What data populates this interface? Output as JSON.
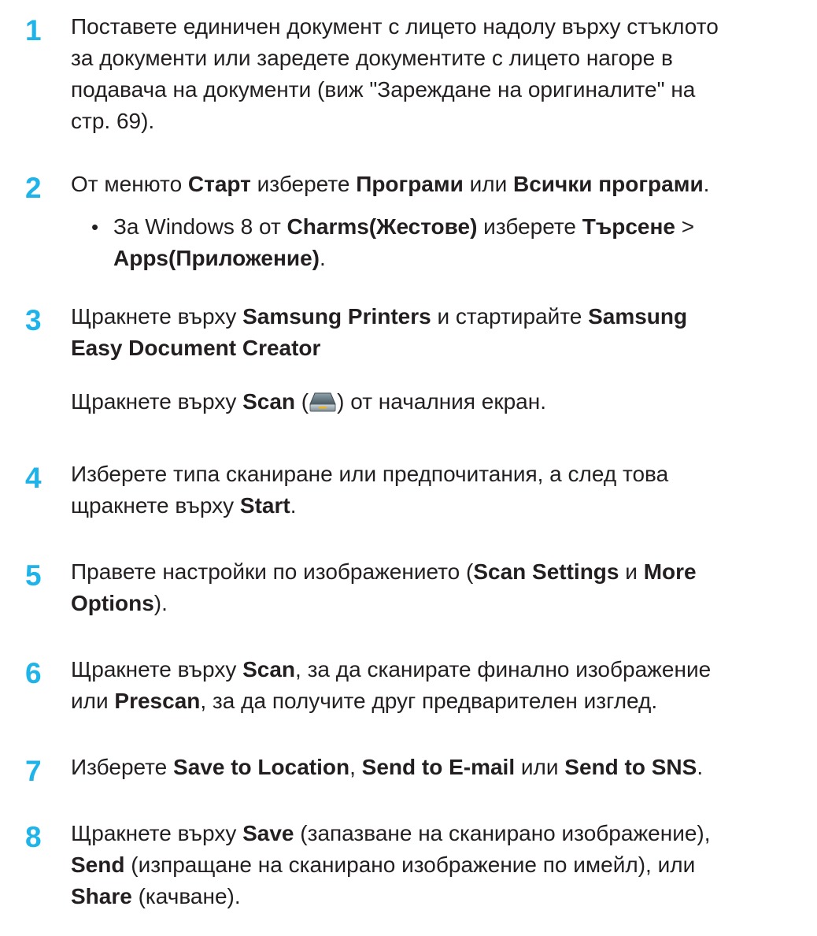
{
  "steps": [
    {
      "number": "1",
      "lines": [
        [
          {
            "t": "Поставете единичен документ с лицето надолу върху стъклото"
          }
        ],
        [
          {
            "t": "за документи или заредете документите с лицето нагоре в"
          }
        ],
        [
          {
            "t": "подавача на документи (виж \"Зареждане на оригиналите\" на"
          }
        ],
        [
          {
            "t": "стр. 69)."
          }
        ]
      ]
    },
    {
      "number": "2",
      "lines": [
        [
          {
            "t": "От менюто "
          },
          {
            "t": "Старт",
            "b": true
          },
          {
            "t": " изберете "
          },
          {
            "t": "Програми",
            "b": true
          },
          {
            "t": " или "
          },
          {
            "t": "Всички програми",
            "b": true
          },
          {
            "t": "."
          }
        ]
      ],
      "bullet": {
        "symbol": "•",
        "lines": [
          [
            {
              "t": "За Windows 8 от "
            },
            {
              "t": "Charms(Жестове)",
              "b": true
            },
            {
              "t": " изберете "
            },
            {
              "t": "Търсене",
              "b": true
            },
            {
              "t": " >"
            }
          ],
          [
            {
              "t": "Apps(Приложение)",
              "b": true
            },
            {
              "t": "."
            }
          ]
        ]
      }
    },
    {
      "number": "3",
      "lines": [
        [
          {
            "t": "Щракнете върху "
          },
          {
            "t": "Samsung Printers",
            "b": true
          },
          {
            "t": " и стартирайте "
          },
          {
            "t": "Samsung",
            "b": true
          }
        ],
        [
          {
            "t": "Easy Document Creator",
            "b": true
          }
        ]
      ],
      "extra": [
        [
          {
            "t": "Щракнете върху "
          },
          {
            "t": "Scan",
            "b": true
          },
          {
            "t": " ("
          },
          {
            "icon": "scanner-icon"
          },
          {
            "t": ") от началния екран."
          }
        ]
      ]
    },
    {
      "number": "4",
      "lines": [
        [
          {
            "t": "Изберете типа сканиране или предпочитания, а след това"
          }
        ],
        [
          {
            "t": "щракнете върху "
          },
          {
            "t": "Start",
            "b": true
          },
          {
            "t": "."
          }
        ]
      ]
    },
    {
      "number": "5",
      "lines": [
        [
          {
            "t": "Правете настройки по изображението ("
          },
          {
            "t": "Scan Settings",
            "b": true
          },
          {
            "t": " и "
          },
          {
            "t": "More",
            "b": true
          }
        ],
        [
          {
            "t": "Options",
            "b": true
          },
          {
            "t": ")."
          }
        ]
      ]
    },
    {
      "number": "6",
      "lines": [
        [
          {
            "t": "Щракнете върху "
          },
          {
            "t": "Scan",
            "b": true
          },
          {
            "t": ", за да сканирате финално изображение"
          }
        ],
        [
          {
            "t": "или "
          },
          {
            "t": "Prescan",
            "b": true
          },
          {
            "t": ", за да получите друг предварителен изглед."
          }
        ]
      ]
    },
    {
      "number": "7",
      "lines": [
        [
          {
            "t": "Изберете "
          },
          {
            "t": "Save to Location",
            "b": true
          },
          {
            "t": ", "
          },
          {
            "t": "Send to E-mail",
            "b": true
          },
          {
            "t": " или "
          },
          {
            "t": "Send to SNS",
            "b": true
          },
          {
            "t": "."
          }
        ]
      ]
    },
    {
      "number": "8",
      "lines": [
        [
          {
            "t": "Щракнете върху "
          },
          {
            "t": "Save",
            "b": true
          },
          {
            "t": " (запазване на сканирано изображение),"
          }
        ],
        [
          {
            "t": "Send",
            "b": true
          },
          {
            "t": " (изпращане на сканирано изображение по имейл), или"
          }
        ],
        [
          {
            "t": "Share",
            "b": true
          },
          {
            "t": " (качване)."
          }
        ]
      ]
    }
  ],
  "colors": {
    "step_number": "#1fb4e9",
    "text": "#231f20"
  }
}
